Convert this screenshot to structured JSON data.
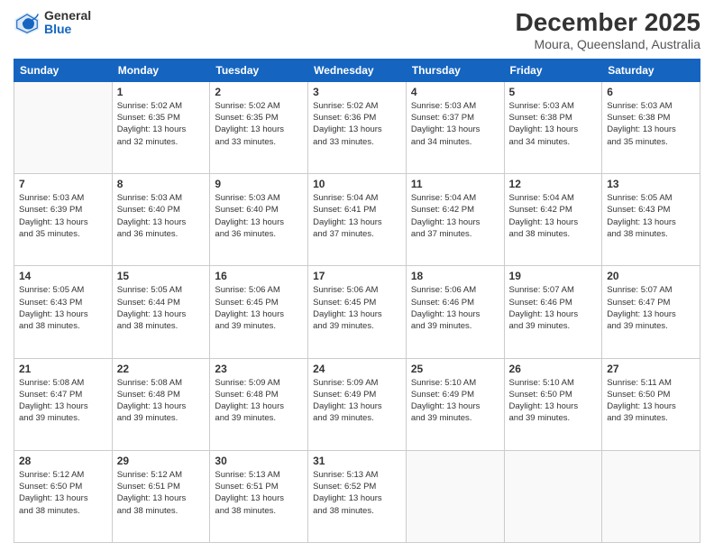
{
  "logo": {
    "general": "General",
    "blue": "Blue"
  },
  "title": "December 2025",
  "location": "Moura, Queensland, Australia",
  "weekdays": [
    "Sunday",
    "Monday",
    "Tuesday",
    "Wednesday",
    "Thursday",
    "Friday",
    "Saturday"
  ],
  "weeks": [
    [
      {
        "day": "",
        "info": ""
      },
      {
        "day": "1",
        "info": "Sunrise: 5:02 AM\nSunset: 6:35 PM\nDaylight: 13 hours\nand 32 minutes."
      },
      {
        "day": "2",
        "info": "Sunrise: 5:02 AM\nSunset: 6:35 PM\nDaylight: 13 hours\nand 33 minutes."
      },
      {
        "day": "3",
        "info": "Sunrise: 5:02 AM\nSunset: 6:36 PM\nDaylight: 13 hours\nand 33 minutes."
      },
      {
        "day": "4",
        "info": "Sunrise: 5:03 AM\nSunset: 6:37 PM\nDaylight: 13 hours\nand 34 minutes."
      },
      {
        "day": "5",
        "info": "Sunrise: 5:03 AM\nSunset: 6:38 PM\nDaylight: 13 hours\nand 34 minutes."
      },
      {
        "day": "6",
        "info": "Sunrise: 5:03 AM\nSunset: 6:38 PM\nDaylight: 13 hours\nand 35 minutes."
      }
    ],
    [
      {
        "day": "7",
        "info": "Sunrise: 5:03 AM\nSunset: 6:39 PM\nDaylight: 13 hours\nand 35 minutes."
      },
      {
        "day": "8",
        "info": "Sunrise: 5:03 AM\nSunset: 6:40 PM\nDaylight: 13 hours\nand 36 minutes."
      },
      {
        "day": "9",
        "info": "Sunrise: 5:03 AM\nSunset: 6:40 PM\nDaylight: 13 hours\nand 36 minutes."
      },
      {
        "day": "10",
        "info": "Sunrise: 5:04 AM\nSunset: 6:41 PM\nDaylight: 13 hours\nand 37 minutes."
      },
      {
        "day": "11",
        "info": "Sunrise: 5:04 AM\nSunset: 6:42 PM\nDaylight: 13 hours\nand 37 minutes."
      },
      {
        "day": "12",
        "info": "Sunrise: 5:04 AM\nSunset: 6:42 PM\nDaylight: 13 hours\nand 38 minutes."
      },
      {
        "day": "13",
        "info": "Sunrise: 5:05 AM\nSunset: 6:43 PM\nDaylight: 13 hours\nand 38 minutes."
      }
    ],
    [
      {
        "day": "14",
        "info": "Sunrise: 5:05 AM\nSunset: 6:43 PM\nDaylight: 13 hours\nand 38 minutes."
      },
      {
        "day": "15",
        "info": "Sunrise: 5:05 AM\nSunset: 6:44 PM\nDaylight: 13 hours\nand 38 minutes."
      },
      {
        "day": "16",
        "info": "Sunrise: 5:06 AM\nSunset: 6:45 PM\nDaylight: 13 hours\nand 39 minutes."
      },
      {
        "day": "17",
        "info": "Sunrise: 5:06 AM\nSunset: 6:45 PM\nDaylight: 13 hours\nand 39 minutes."
      },
      {
        "day": "18",
        "info": "Sunrise: 5:06 AM\nSunset: 6:46 PM\nDaylight: 13 hours\nand 39 minutes."
      },
      {
        "day": "19",
        "info": "Sunrise: 5:07 AM\nSunset: 6:46 PM\nDaylight: 13 hours\nand 39 minutes."
      },
      {
        "day": "20",
        "info": "Sunrise: 5:07 AM\nSunset: 6:47 PM\nDaylight: 13 hours\nand 39 minutes."
      }
    ],
    [
      {
        "day": "21",
        "info": "Sunrise: 5:08 AM\nSunset: 6:47 PM\nDaylight: 13 hours\nand 39 minutes."
      },
      {
        "day": "22",
        "info": "Sunrise: 5:08 AM\nSunset: 6:48 PM\nDaylight: 13 hours\nand 39 minutes."
      },
      {
        "day": "23",
        "info": "Sunrise: 5:09 AM\nSunset: 6:48 PM\nDaylight: 13 hours\nand 39 minutes."
      },
      {
        "day": "24",
        "info": "Sunrise: 5:09 AM\nSunset: 6:49 PM\nDaylight: 13 hours\nand 39 minutes."
      },
      {
        "day": "25",
        "info": "Sunrise: 5:10 AM\nSunset: 6:49 PM\nDaylight: 13 hours\nand 39 minutes."
      },
      {
        "day": "26",
        "info": "Sunrise: 5:10 AM\nSunset: 6:50 PM\nDaylight: 13 hours\nand 39 minutes."
      },
      {
        "day": "27",
        "info": "Sunrise: 5:11 AM\nSunset: 6:50 PM\nDaylight: 13 hours\nand 39 minutes."
      }
    ],
    [
      {
        "day": "28",
        "info": "Sunrise: 5:12 AM\nSunset: 6:50 PM\nDaylight: 13 hours\nand 38 minutes."
      },
      {
        "day": "29",
        "info": "Sunrise: 5:12 AM\nSunset: 6:51 PM\nDaylight: 13 hours\nand 38 minutes."
      },
      {
        "day": "30",
        "info": "Sunrise: 5:13 AM\nSunset: 6:51 PM\nDaylight: 13 hours\nand 38 minutes."
      },
      {
        "day": "31",
        "info": "Sunrise: 5:13 AM\nSunset: 6:52 PM\nDaylight: 13 hours\nand 38 minutes."
      },
      {
        "day": "",
        "info": ""
      },
      {
        "day": "",
        "info": ""
      },
      {
        "day": "",
        "info": ""
      }
    ]
  ]
}
